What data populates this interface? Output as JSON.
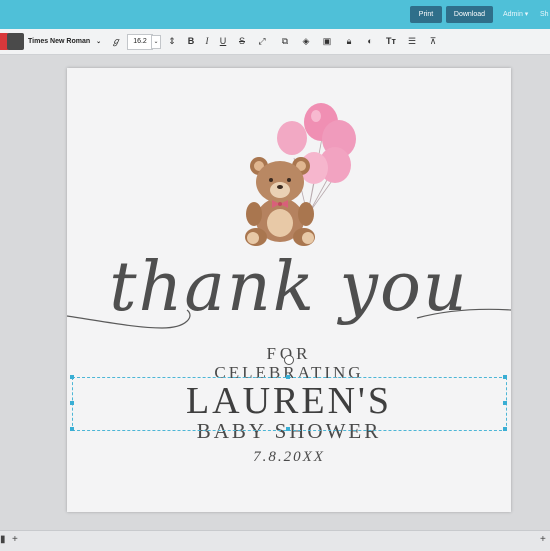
{
  "topbar": {
    "print_label": "Print",
    "download_label": "Download",
    "admin_label": "Admin ▾",
    "share_label": "Sh"
  },
  "toolbar": {
    "font_family": "Times New Roman",
    "font_size": "16.2",
    "swatch_colors": [
      "#d8383b",
      "#4a4a4a"
    ]
  },
  "card": {
    "script_heading": "thank you",
    "for": "FOR",
    "celebrating": "CELEBRATING",
    "name": "LAUREN'S",
    "event": "BABY SHOWER",
    "date": "7.8.20XX",
    "balloon_color": "#f0a3c1",
    "bear_color": "#b58461"
  },
  "bottombar": {
    "left_label": "+",
    "right_label": "+"
  }
}
